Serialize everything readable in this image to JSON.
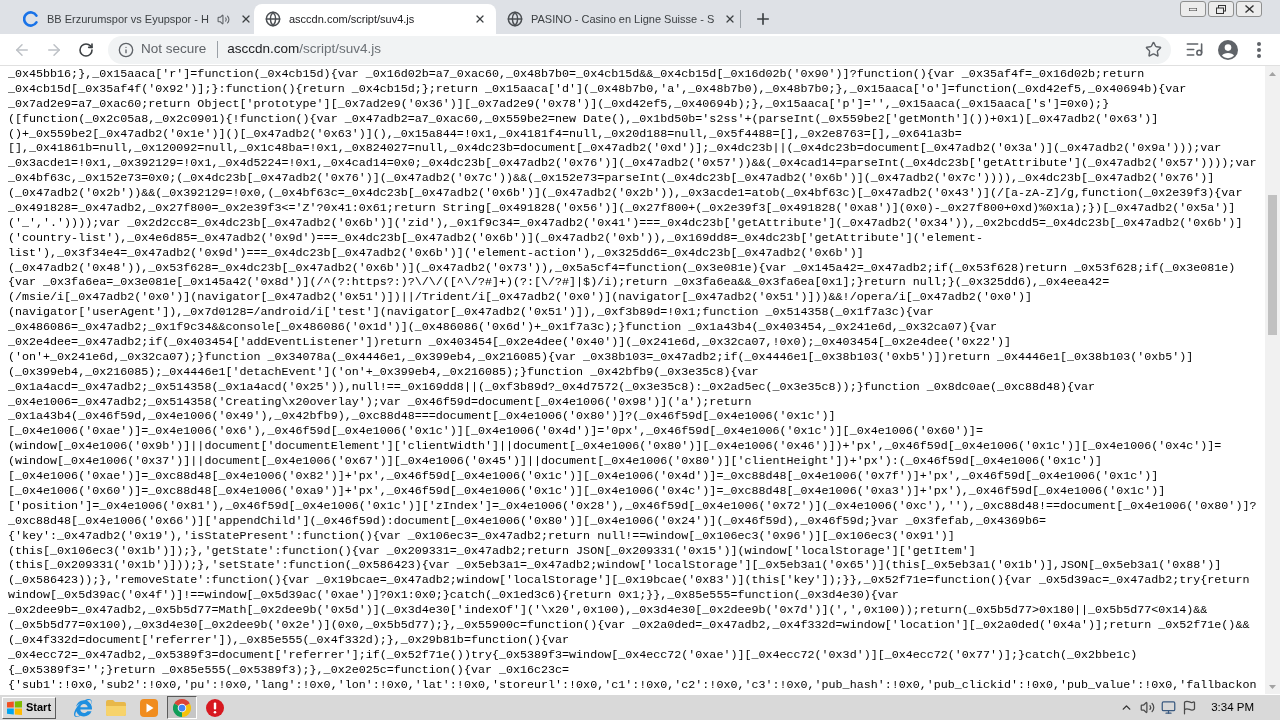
{
  "tabs": [
    {
      "title": "BB Erzurumspor vs Eyupspor - H",
      "kind": "branded",
      "audio_playing": true,
      "selected": false
    },
    {
      "title": "asccdn.com/script/suv4.js",
      "kind": "plain",
      "audio_playing": false,
      "selected": true
    },
    {
      "title": "PASINO - Casino en Ligne Suisse - S",
      "kind": "plain",
      "audio_playing": false,
      "selected": false
    }
  ],
  "navigation": {
    "back": {
      "disabled": true
    },
    "forward": {
      "disabled": true
    }
  },
  "address_bar": {
    "security_label": "Not secure",
    "host": "asccdn.com",
    "path": "/script/suv4.js"
  },
  "page": {
    "lines": [
      "_0x45bb16;},_0x15aaca['r']=function(_0x4cb15d){var _0x16d02b=a7_0xac60,_0x48b7b0=_0x4cb15d&&_0x4cb15d[_0x16d02b('0x90')]?function(){var _0x35af4f=_0x16d02b;return",
      "_0x4cb15d[_0x35af4f('0x92')];}:function(){return _0x4cb15d;};return _0x15aaca['d'](_0x48b7b0,'a',_0x48b7b0),_0x48b7b0;},_0x15aaca['o']=function(_0xd42ef5,_0x40694b){var",
      "_0x7ad2e9=a7_0xac60;return Object['prototype'][_0x7ad2e9('0x36')][_0x7ad2e9('0x78')](_0xd42ef5,_0x40694b);},_0x15aaca['p']='',_0x15aaca(_0x15aaca['s']=0x0);}",
      "([function(_0x2c05a8,_0x2c0901){!function(){var _0x47adb2=a7_0xac60,_0x559be2=new Date(),_0x1bd50b='s2ss'+(parseInt(_0x559be2['getMonth']())+0x1)[_0x47adb2('0x63')]",
      "()+_0x559be2[_0x47adb2('0x1e')]()[_0x47adb2('0x63')](),_0x15a844=!0x1,_0x4181f4=null,_0x20d188=null,_0x5f4488=[],_0x2e8763=[],_0x641a3b=",
      "[],_0x41861b=null,_0x120092=null,_0x1c48ba=!0x1,_0x824027=null,_0x4dc23b=document[_0x47adb2('0xd')];_0x4dc23b||(_0x4dc23b=document[_0x47adb2('0x3a')](_0x47adb2('0x9a')));var",
      "_0x3acde1=!0x1,_0x392129=!0x1,_0x4d5224=!0x1,_0x4cad14=0x0;_0x4dc23b[_0x47adb2('0x76')](_0x47adb2('0x57'))&&(_0x4cad14=parseInt(_0x4dc23b['getAttribute'](_0x47adb2('0x57'))));var",
      "_0x4bf63c,_0x152e73=0x0;(_0x4dc23b[_0x47adb2('0x76')](_0x47adb2('0x7c'))&&(_0x152e73=parseInt(_0x4dc23b[_0x47adb2('0x6b')](_0x47adb2('0x7c')))),_0x4dc23b[_0x47adb2('0x76')]",
      "(_0x47adb2('0x2b'))&&(_0x392129=!0x0,(_0x4bf63c=_0x4dc23b[_0x47adb2('0x6b')](_0x47adb2('0x2b')),_0x3acde1=atob(_0x4bf63c)[_0x47adb2('0x43')](/[a-zA-Z]/g,function(_0x2e39f3){var",
      "_0x491828=_0x47adb2,_0x27f800=_0x2e39f3<='Z'?0x41:0x61;return String[_0x491828('0x56')](_0x27f800+(_0x2e39f3[_0x491828('0xa8')](0x0)-_0x27f800+0xd)%0x1a);})[_0x47adb2('0x5a')]",
      "('_','.'))));var _0x2d2cc8=_0x4dc23b[_0x47adb2('0x6b')]('zid'),_0x1f9c34=_0x47adb2('0x41')===_0x4dc23b['getAttribute'](_0x47adb2('0x34')),_0x2bcdd5=_0x4dc23b[_0x47adb2('0x6b')]",
      "('country-list'),_0x4e6d85=_0x47adb2('0x9d')===_0x4dc23b[_0x47adb2('0x6b')](_0x47adb2('0xb')),_0x169dd8=_0x4dc23b['getAttribute']('element-",
      "list'),_0x3f34e4=_0x47adb2('0x9d')===_0x4dc23b[_0x47adb2('0x6b')]('element-action'),_0x325dd6=_0x4dc23b[_0x47adb2('0x6b')]",
      "(_0x47adb2('0x48')),_0x53f628=_0x4dc23b[_0x47adb2('0x6b')](_0x47adb2('0x73')),_0x5a5cf4=function(_0x3e081e){var _0x145a42=_0x47adb2;if(_0x53f628)return _0x53f628;if(_0x3e081e)",
      "{var _0x3fa6ea=_0x3e081e[_0x145a42('0x8d')](/^(?:https?:)?\\/\\/([^\\/?#]+)(?:[\\/?#]|$)/i);return _0x3fa6ea&&_0x3fa6ea[0x1];}return null;}(_0x325dd6),_0x4eea42=",
      "(/msie/i[_0x47adb2('0x0')](navigator[_0x47adb2('0x51')])||/Trident/i[_0x47adb2('0x0')](navigator[_0x47adb2('0x51')]))&&!/opera/i[_0x47adb2('0x0')]",
      "(navigator['userAgent']),_0x7d0128=/android/i['test'](navigator[_0x47adb2('0x51')]),_0xf3b89d=!0x1;function _0x514358(_0x1f7a3c){var",
      "_0x486086=_0x47adb2;_0x1f9c34&&console[_0x486086('0x1d')](_0x486086('0x6d')+_0x1f7a3c);}function _0x1a43b4(_0x403454,_0x241e6d,_0x32ca07){var",
      "_0x2e4dee=_0x47adb2;if(_0x403454['addEventListener'])return _0x403454[_0x2e4dee('0x40')](_0x241e6d,_0x32ca07,!0x0);_0x403454[_0x2e4dee('0x22')]",
      "('on'+_0x241e6d,_0x32ca07);}function _0x34078a(_0x4446e1,_0x399eb4,_0x216085){var _0x38b103=_0x47adb2;if(_0x4446e1[_0x38b103('0xb5')])return _0x4446e1[_0x38b103('0xb5')]",
      "(_0x399eb4,_0x216085);_0x4446e1['detachEvent']('on'+_0x399eb4,_0x216085);}function _0x42bfb9(_0x3e35c8){var",
      "_0x1a4acd=_0x47adb2;_0x514358(_0x1a4acd('0x25')),null!==_0x169dd8||(_0xf3b89d?_0x4d7572(_0x3e35c8):_0x2ad5ec(_0x3e35c8));}function _0x8dc0ae(_0xc88d48){var",
      "_0x4e1006=_0x47adb2;_0x514358('Creating\\x20overlay');var _0x46f59d=document[_0x4e1006('0x98')]('a');return",
      "_0x1a43b4(_0x46f59d,_0x4e1006('0x49'),_0x42bfb9),_0xc88d48===document[_0x4e1006('0x80')]?(_0x46f59d[_0x4e1006('0x1c')]",
      "[_0x4e1006('0xae')]=_0x4e1006('0x6'),_0x46f59d[_0x4e1006('0x1c')][_0x4e1006('0x4d')]='0px',_0x46f59d[_0x4e1006('0x1c')][_0x4e1006('0x60')]=",
      "(window[_0x4e1006('0x9b')]||document['documentElement']['clientWidth']||document[_0x4e1006('0x80')][_0x4e1006('0x46')])+'px',_0x46f59d[_0x4e1006('0x1c')][_0x4e1006('0x4c')]=",
      "(window[_0x4e1006('0x37')]||document[_0x4e1006('0x67')][_0x4e1006('0x45')]||document[_0x4e1006('0x80')]['clientHeight'])+'px'):(_0x46f59d[_0x4e1006('0x1c')]",
      "[_0x4e1006('0xae')]=_0xc88d48[_0x4e1006('0x82')]+'px',_0x46f59d[_0x4e1006('0x1c')][_0x4e1006('0x4d')]=_0xc88d48[_0x4e1006('0x7f')]+'px',_0x46f59d[_0x4e1006('0x1c')]",
      "[_0x4e1006('0x60')]=_0xc88d48[_0x4e1006('0xa9')]+'px',_0x46f59d[_0x4e1006('0x1c')][_0x4e1006('0x4c')]=_0xc88d48[_0x4e1006('0xa3')]+'px'),_0x46f59d[_0x4e1006('0x1c')]",
      "['position']=_0x4e1006('0x81'),_0x46f59d[_0x4e1006('0x1c')]['zIndex']=_0x4e1006('0x28'),_0x46f59d[_0x4e1006('0x72')](_0x4e1006('0xc'),''),_0xc88d48!==document[_0x4e1006('0x80')]?",
      "_0xc88d48[_0x4e1006('0x66')]['appendChild'](_0x46f59d):document[_0x4e1006('0x80')][_0x4e1006('0x24')](_0x46f59d),_0x46f59d;}var _0x3fefab,_0x4369b6=",
      "{'key':_0x47adb2('0x19'),'isStatePresent':function(){var _0x106ec3=_0x47adb2;return null!==window[_0x106ec3('0x96')][_0x106ec3('0x91')]",
      "(this[_0x106ec3('0x1b')]);},'getState':function(){var _0x209331=_0x47adb2;return JSON[_0x209331('0x15')](window['localStorage']['getItem']",
      "(this[_0x209331('0x1b')]));},'setState':function(_0x586423){var _0x5eb3a1=_0x47adb2;window['localStorage'][_0x5eb3a1('0x65')](this[_0x5eb3a1('0x1b')],JSON[_0x5eb3a1('0x88')]",
      "(_0x586423));},'removeState':function(){var _0x19bcae=_0x47adb2;window['localStorage'][_0x19bcae('0x83')](this['key']);}},_0x52f71e=function(){var _0x5d39ac=_0x47adb2;try{return",
      "window[_0x5d39ac('0x4f')]!==window[_0x5d39ac('0xae')]?0x1:0x0;}catch(_0x1ed3c6){return 0x1;}},_0x85e555=function(_0x3d4e30){var",
      "_0x2dee9b=_0x47adb2,_0x5b5d77=Math[_0x2dee9b('0x5d')](_0x3d4e30['indexOf']('\\x20',0x100),_0x3d4e30[_0x2dee9b('0x7d')](',',0x100));return(_0x5b5d77>0x180||_0x5b5d77<0x14)&&",
      "(_0x5b5d77=0x100),_0x3d4e30[_0x2dee9b('0x2e')](0x0,_0x5b5d77);},_0x55900c=function(){var _0x2a0ded=_0x47adb2,_0x4f332d=window['location'][_0x2a0ded('0x4a')];return _0x52f71e()&&",
      "(_0x4f332d=document['referrer']),_0x85e555(_0x4f332d);},_0x29b81b=function(){var",
      "_0x4ecc72=_0x47adb2,_0x5389f3=document['referrer'];if(_0x52f71e())try{_0x5389f3=window[_0x4ecc72('0xae')][_0x4ecc72('0x3d')][_0x4ecc72('0x77')];}catch(_0x2bbe1c)",
      "{_0x5389f3='';}return _0x85e555(_0x5389f3);},_0x2e025c=function(){var _0x16c23c=",
      "{'sub1':!0x0,'sub2':!0x0,'pu':!0x0,'lang':!0x0,'lon':!0x0,'lat':!0x0,'storeurl':!0x0,'c1':!0x0,'c2':!0x0,'c3':!0x0,'pub_hash':!0x0,'pub_clickid':!0x0,'pub_value':!0x0,'fallbackon"
    ]
  },
  "taskbar": {
    "start_label": "Start",
    "apps": [
      {
        "kind": "e_logo",
        "selected": false
      },
      {
        "kind": "folder",
        "selected": false
      },
      {
        "kind": "player",
        "selected": false
      },
      {
        "kind": "round_logo",
        "selected": true
      },
      {
        "kind": "alert",
        "selected": false
      }
    ],
    "clock": "3:34 PM"
  }
}
